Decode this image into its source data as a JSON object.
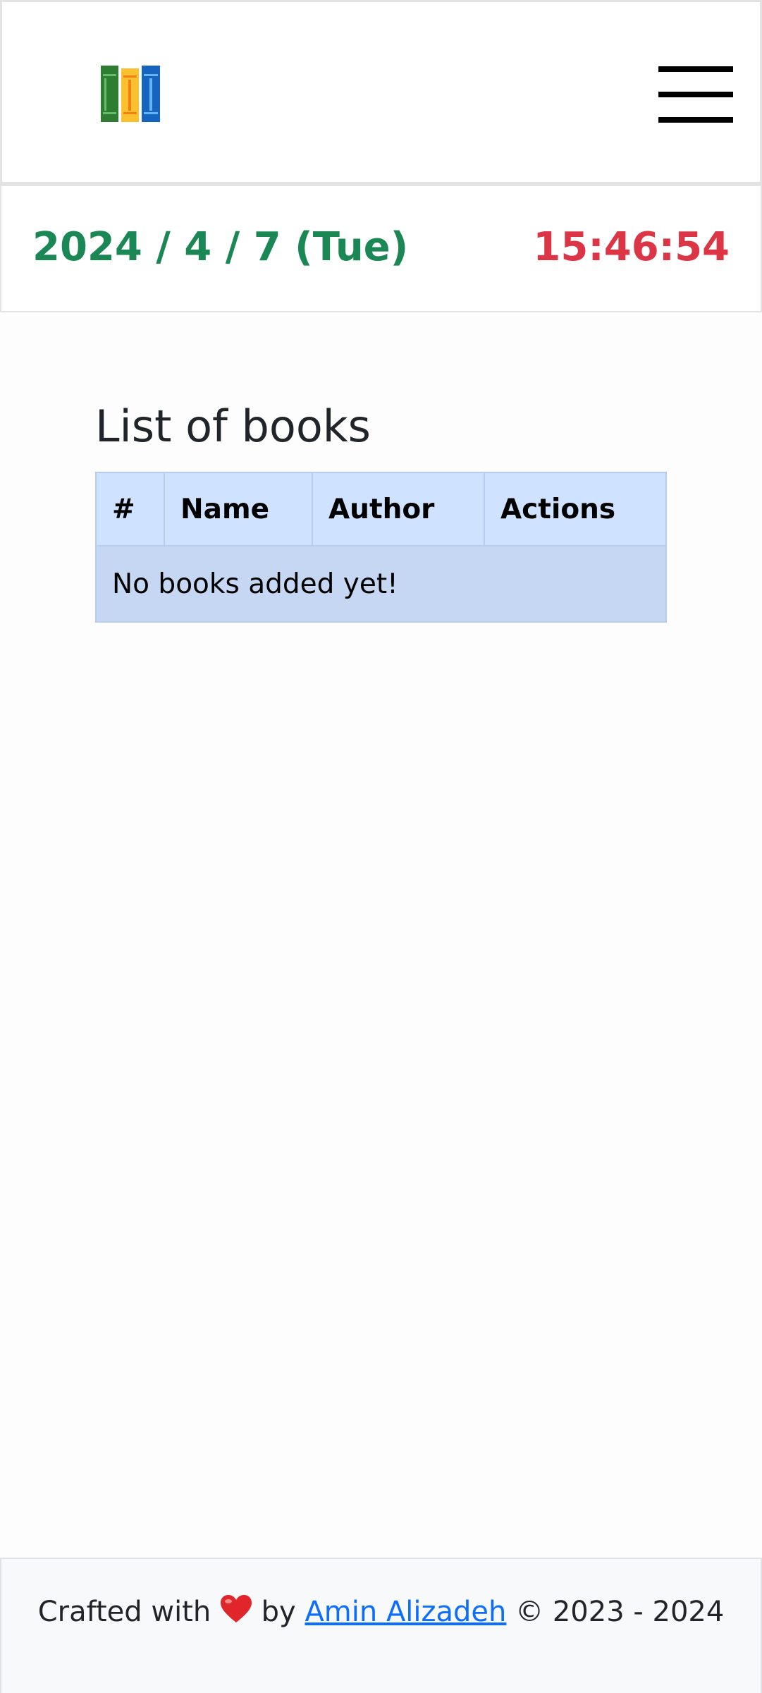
{
  "header": {
    "logo_icon": "books-logo-icon",
    "menu_icon": "hamburger-menu-icon"
  },
  "datebar": {
    "date": "2024 / 4 / 7 (Tue)",
    "time": "15:46:54",
    "date_color": "#1a8754",
    "time_color": "#dc3545"
  },
  "main": {
    "title": "List of books",
    "table": {
      "columns": [
        "#",
        "Name",
        "Author",
        "Actions"
      ],
      "empty_message": "No books added yet!"
    }
  },
  "footer": {
    "prefix": "Crafted with",
    "heart_icon": "heart-icon",
    "by": "by",
    "author_link": "Amin Alizadeh",
    "suffix": "© 2023 - 2024",
    "link_color": "#0d6efd"
  }
}
